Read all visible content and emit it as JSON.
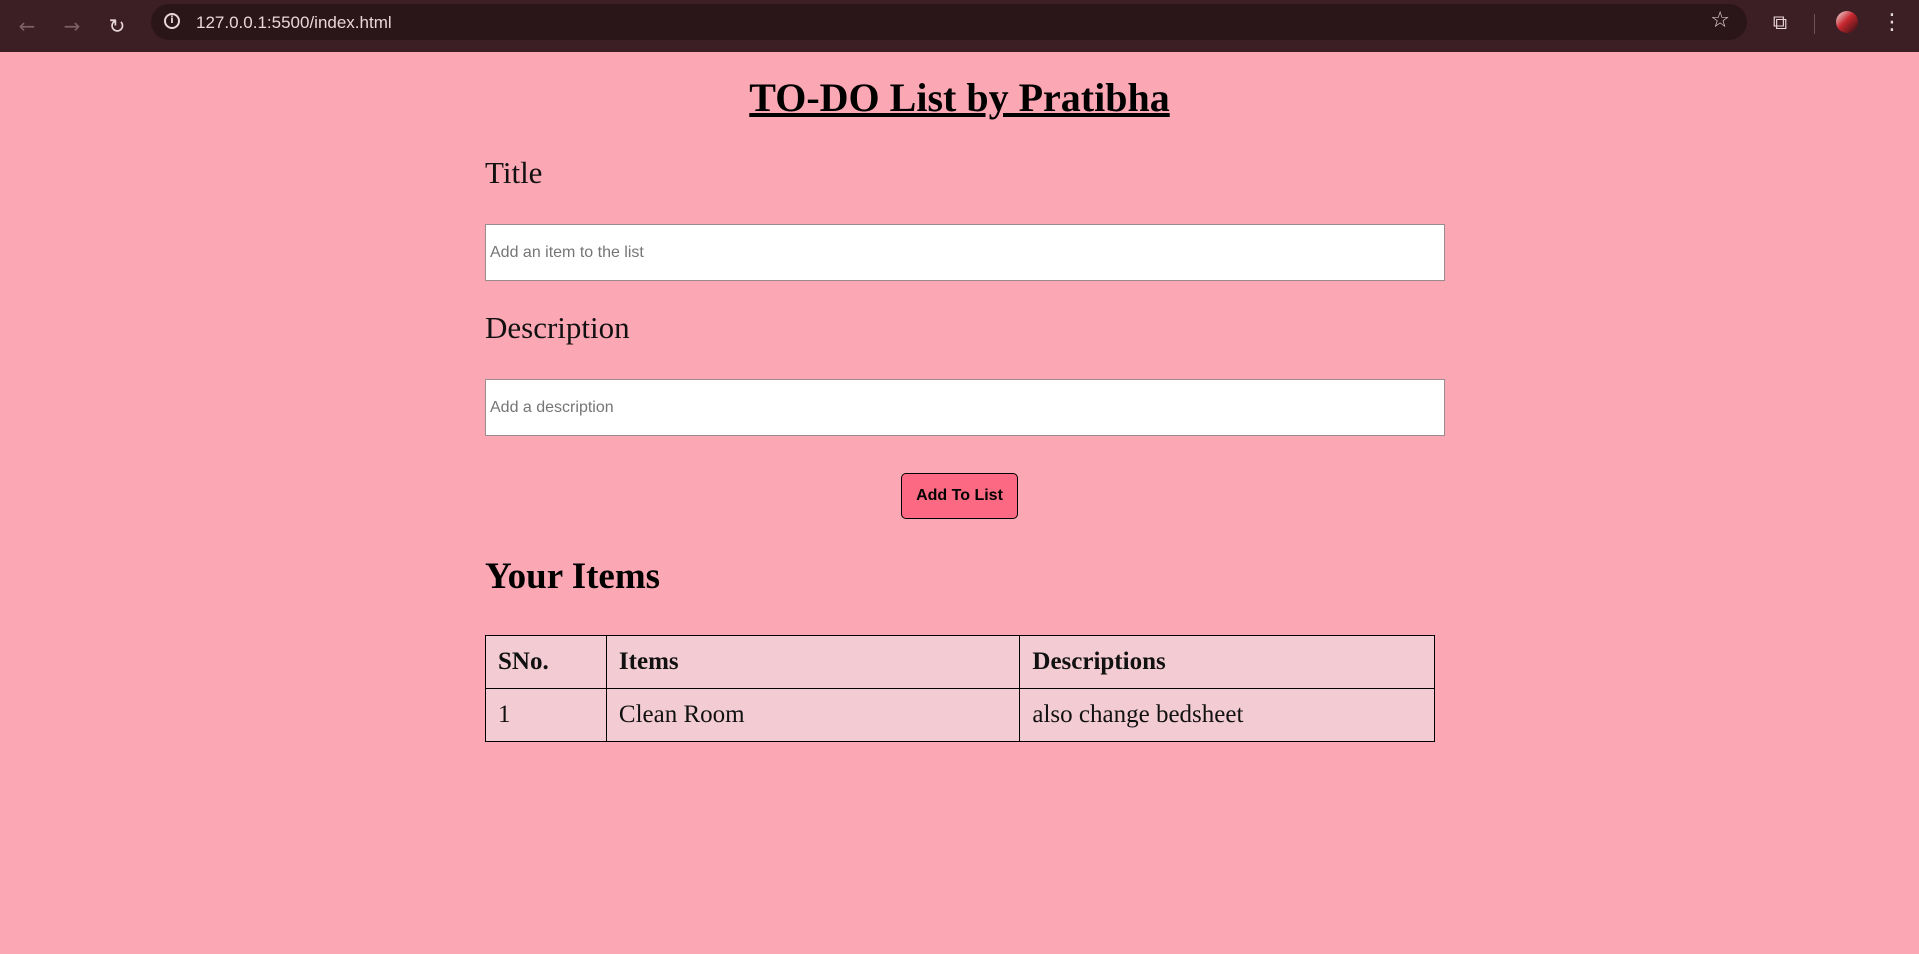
{
  "browser": {
    "url": "127.0.0.1:5500/index.html",
    "icons": {
      "back": "arrow-left-icon",
      "forward": "arrow-right-icon",
      "reload": "reload-icon",
      "site_info": "info-icon",
      "bookmark": "star-icon",
      "extensions": "puzzle-icon",
      "menu": "kebab-menu-icon"
    }
  },
  "page": {
    "title": "TO-DO List by Pratibha",
    "background_color": "#fca7b4",
    "form": {
      "title_label": "Title",
      "title_input": {
        "value": "",
        "placeholder": "Add an item to the list"
      },
      "description_label": "Description",
      "description_input": {
        "value": "",
        "placeholder": "Add a description"
      },
      "submit_label": "Add To List",
      "submit_color": "#fb6a82"
    },
    "items_section": {
      "heading": "Your Items",
      "table": {
        "headers": [
          "SNo.",
          "Items",
          "Descriptions"
        ],
        "rows": [
          [
            "1",
            "Clean Room",
            "also change bedsheet"
          ]
        ]
      }
    }
  }
}
